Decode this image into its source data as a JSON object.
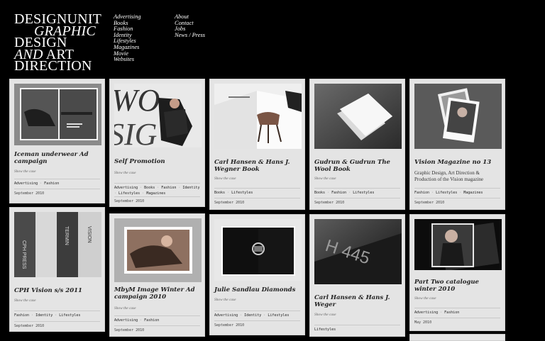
{
  "brand": {
    "line1": "DESIGNUNIT",
    "line2": "GRAPHIC",
    "line3": "DESIGN",
    "line4_a": "AND",
    "line4_b": " ART",
    "line5": "DIRECTION"
  },
  "nav_primary": [
    "Advertising",
    "Books",
    "Fashion",
    "Identity",
    "Lifestyles",
    "Magazines",
    "Movie",
    "Websites"
  ],
  "nav_secondary": [
    "About",
    "Contact",
    "Jobs",
    "News / Press"
  ],
  "cards": [
    {
      "title": "Iceman underwear Ad campaign",
      "description": "",
      "show": "Show the case",
      "tags": [
        "Advertising",
        "Fashion"
      ],
      "date": "September 2010",
      "image": "man-lying-bench-photo"
    },
    {
      "title": "Self Promotion",
      "description": "",
      "show": "Show the case",
      "tags": [
        "Advertising",
        "Books",
        "Fashion",
        "Identity",
        "Lifestyles",
        "Magazines"
      ],
      "date": "September 2010",
      "image": "large-type-woman-photo"
    },
    {
      "title": "Carl Hansen & Hans J. Wegner Book",
      "description": "",
      "show": "Show the case",
      "tags": [
        "Books",
        "Lifestyles"
      ],
      "date": "September 2010",
      "image": "open-book-chair-photo"
    },
    {
      "title": "Gudrun & Gudrun The Wool Book",
      "description": "",
      "show": "Show the case",
      "tags": [
        "Books",
        "Fashion",
        "Lifestyles"
      ],
      "date": "September 2010",
      "image": "white-book-photo"
    },
    {
      "title": "Vision Magazine no 13",
      "description": "Graphic Design, Art Direction & Production of the Vision magazine",
      "show": "",
      "tags": [
        "Fashion",
        "Lifestyles",
        "Magazines"
      ],
      "date": "September 2010",
      "image": "magazine-stack-photo"
    },
    {
      "title": "CPH Vision s/s 2011",
      "description": "",
      "show": "Show the case",
      "tags": [
        "Fashion",
        "Identity",
        "Lifestyles"
      ],
      "date": "September 2010",
      "image": "press-folders-photo"
    },
    {
      "title": "MbyM Image Winter Ad campaign 2010",
      "description": "",
      "show": "Show the case",
      "tags": [
        "Advertising",
        "Fashion"
      ],
      "date": "September 2010",
      "image": "woman-reclining-photo"
    },
    {
      "title": "Julie Sandlau Diamonds",
      "description": "",
      "show": "Show the case",
      "tags": [
        "Advertising",
        "Identity",
        "Lifestyles"
      ],
      "date": "September 2010",
      "image": "black-brochure-ring-photo"
    },
    {
      "title": "Carl Hansen & Hans J. Weger",
      "description": "",
      "show": "Show the case",
      "tags": [
        "Lifestyles"
      ],
      "date": "",
      "image": "dark-cover-ch445-photo"
    },
    {
      "title": "Part Two catalogue winter 2010",
      "description": "",
      "show": "Show the case",
      "tags": [
        "Advertising",
        "Fashion"
      ],
      "date": "May 2010",
      "image": "catalogue-woman-photo"
    }
  ]
}
